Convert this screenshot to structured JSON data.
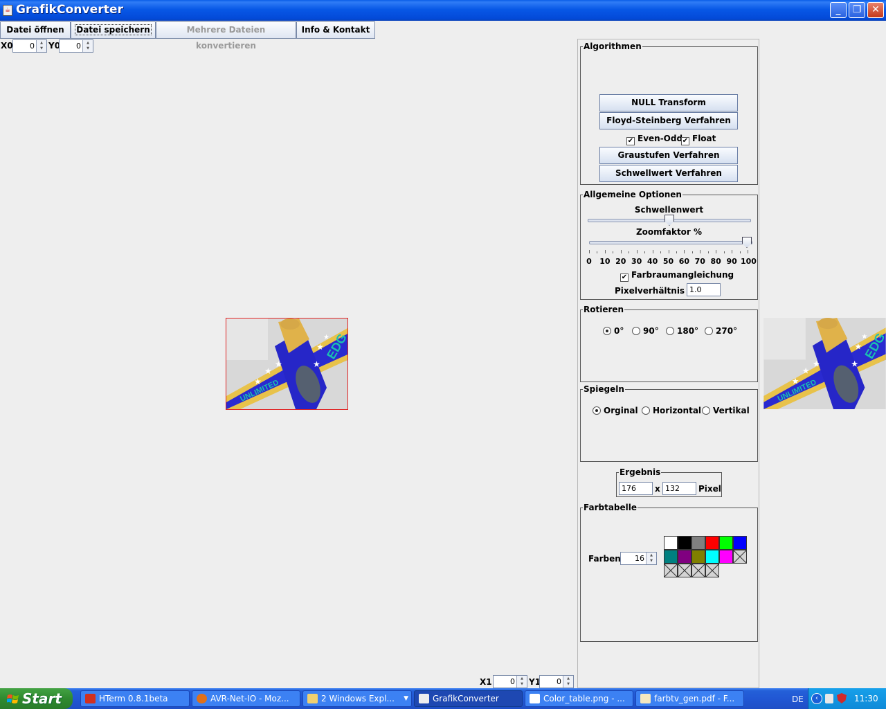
{
  "window": {
    "title": "GrafikConverter"
  },
  "toolbar": {
    "open": "Datei öffnen",
    "save": "Datei speichern",
    "batch": "Mehrere Dateien konvertieren",
    "info": "Info & Kontakt"
  },
  "coords": {
    "x0_label": "X0",
    "x0": "0",
    "y0_label": "Y0",
    "y0": "0",
    "x1_label": "X1",
    "x1": "0",
    "y1_label": "Y1",
    "y1": "0"
  },
  "algorithms": {
    "title": "Algorithmen",
    "null": "NULL Transform",
    "floyd": "Floyd-Steinberg Verfahren",
    "even_odd": "Even-Odd",
    "float": "Float",
    "gray": "Graustufen Verfahren",
    "threshold": "Schwellwert Verfahren"
  },
  "options": {
    "title": "Allgemeine Optionen",
    "threshold_label": "Schwellenwert",
    "threshold_value_fraction": 0.5,
    "zoom_label": "Zoomfaktor %",
    "zoom_value": 100,
    "zoom_ticks": [
      "0",
      "10",
      "20",
      "30",
      "40",
      "50",
      "60",
      "70",
      "80",
      "90",
      "100"
    ],
    "color_match": "Farbraumangleichung",
    "pixel_ratio_label": "Pixelverhältnis 1 :",
    "pixel_ratio": "1.0"
  },
  "rotate": {
    "title": "Rotieren",
    "options": [
      "0°",
      "90°",
      "180°",
      "270°"
    ],
    "selected": "0°"
  },
  "mirror": {
    "title": "Spiegeln",
    "options": [
      "Orginal",
      "Horizontal",
      "Vertikal"
    ],
    "selected": "Orginal"
  },
  "result": {
    "title": "Ergebnis",
    "width": "176",
    "x": "x",
    "height": "132",
    "unit": "Pixel"
  },
  "palette": {
    "title": "Farbtabelle",
    "colors_label": "Farben:",
    "colors": "16",
    "swatches": [
      "#ffffff",
      "#000000",
      "#808080",
      "#ff0000",
      "#00ff00",
      "#0000ff",
      "#008080",
      "#800080",
      "#808000",
      "#00ffff",
      "#ff00ff"
    ]
  },
  "taskbar": {
    "start": "Start",
    "tasks": [
      "HTerm 0.8.1beta",
      "AVR-Net-IO - Moz...",
      "2 Windows Expl...",
      "GrafikConverter",
      "Color_table.png - ...",
      "farbtv_gen.pdf - F..."
    ],
    "lang": "DE",
    "clock": "11:30"
  }
}
